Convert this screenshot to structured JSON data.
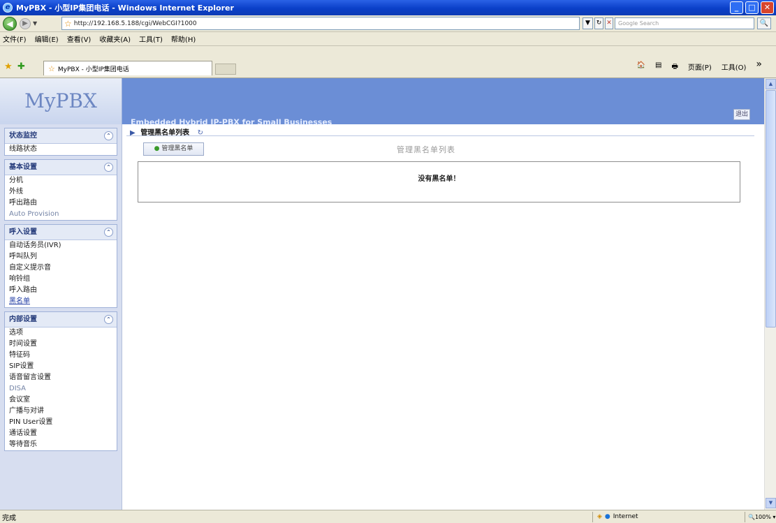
{
  "window": {
    "title": "MyPBX - 小型IP集团电话 - Windows Internet Explorer",
    "minimize": "_",
    "maximize": "□",
    "close": "✕"
  },
  "address": {
    "url": "http://192.168.5.188/cgi/WebCGI?1000",
    "search_placeholder": "Google Search",
    "refresh": "↻",
    "stop": "✕",
    "go": "🔍"
  },
  "menu": [
    "文件(F)",
    "编辑(E)",
    "查看(V)",
    "收藏夹(A)",
    "工具(T)",
    "帮助(H)"
  ],
  "tab": {
    "label": "MyPBX - 小型IP集团电话"
  },
  "commands": [
    "🏠",
    "▤",
    "🖶",
    "页面(P)",
    "工具(O)",
    "»"
  ],
  "header": {
    "logo": "MyPBX",
    "tagline": "Embedded Hybrid IP-PBX for Small Businesses",
    "logout": "退出"
  },
  "sidebar": {
    "groups": [
      {
        "title": "状态监控",
        "items": [
          "线路状态"
        ]
      },
      {
        "title": "基本设置",
        "items": [
          "分机",
          "外线",
          "呼出路由",
          "Auto Provision"
        ]
      },
      {
        "title": "呼入设置",
        "items": [
          "自动话务员(IVR)",
          "呼叫队列",
          "自定义提示音",
          "响铃组",
          "呼入路由",
          "黑名单"
        ]
      },
      {
        "title": "内部设置",
        "items": [
          "选项",
          "时间设置",
          "特征码",
          "SIP设置",
          "语音留言设置",
          "DISA",
          "会议室",
          "广播与对讲",
          "PIN User设置",
          "通话设置",
          "等待音乐"
        ]
      }
    ]
  },
  "main": {
    "breadcrumb": "管理黑名单列表",
    "manage_button": "管理黑名单",
    "page_title": "管理黑名单列表",
    "empty_message": "没有黑名单！"
  },
  "status": {
    "left": "完成",
    "zone": "Internet",
    "zoom": "100%"
  },
  "colors": {
    "header_bg": "#6b8ed6",
    "sidebar_bg": "#d7def0",
    "titlebar_bg": "#0a3fc8"
  }
}
